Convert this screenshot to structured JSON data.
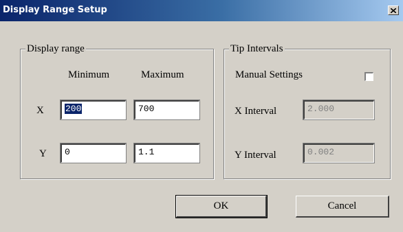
{
  "window": {
    "title": "Display Range Setup"
  },
  "display_range": {
    "group_label": "Display range",
    "col_min": "Minimum",
    "col_max": "Maximum",
    "x_label": "X",
    "y_label": "Y",
    "x_min": "200",
    "x_max": "700",
    "y_min": "0",
    "y_max": "1.1"
  },
  "tip_intervals": {
    "group_label": "Tip Intervals",
    "manual_label": "Manual Settings",
    "manual_checked": false,
    "x_interval_label": "X Interval",
    "x_interval_value": "2.000",
    "y_interval_label": "Y Interval",
    "y_interval_value": "0.002"
  },
  "buttons": {
    "ok": "OK",
    "cancel": "Cancel"
  },
  "icons": {
    "close": "close-icon"
  }
}
